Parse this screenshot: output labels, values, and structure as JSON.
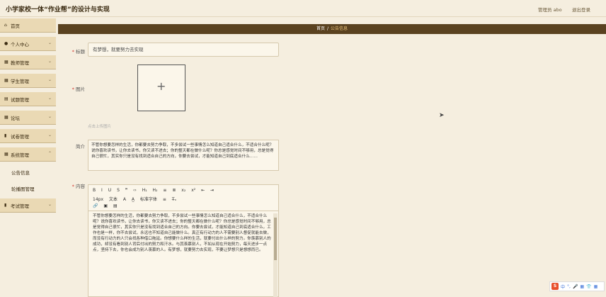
{
  "app": {
    "title": "小学家校一体“作业帮”的设计与实现",
    "user": "管理员 abo",
    "logout": "退出登录"
  },
  "sidebar": {
    "items": [
      {
        "label": "首页",
        "icon": "home-icon",
        "glyph": "⌂"
      },
      {
        "label": "个人中心",
        "icon": "user-icon",
        "glyph": "●"
      },
      {
        "label": "教师管理",
        "icon": "grid-icon",
        "glyph": "▦"
      },
      {
        "label": "学生管理",
        "icon": "grid-icon",
        "glyph": "▦"
      },
      {
        "label": "试题管理",
        "icon": "list-icon",
        "glyph": "▤"
      },
      {
        "label": "论坛",
        "icon": "grid-icon",
        "glyph": "▦"
      },
      {
        "label": "试卷管理",
        "icon": "doc-icon",
        "glyph": "▮"
      },
      {
        "label": "系统管理",
        "icon": "grid-icon",
        "glyph": "▦"
      },
      {
        "label": "考试管理",
        "icon": "doc-icon",
        "glyph": "▮"
      }
    ],
    "subitems": [
      "公告信息",
      "轮播图管理"
    ]
  },
  "breadcrumb": {
    "home": "首页",
    "separator": "/",
    "current": "公告信息"
  },
  "form": {
    "title_label": "标题",
    "title_value": "有梦想，就要努力去实现",
    "image_label": "图片",
    "image_hint": "点击上传图片",
    "summary_label": "简介",
    "summary_value": "不管你想要怎样的生活，你都要去努力争取，不多尝试一些事情怎么知道自己适合什么，不适合什么呢？说你喜欢读书，让你去读书，你又读不进去；你的整天都在做什么呢？你总是感觉时间不够用，总是觉得自己很忙，其实你只是没有找到适合自己的方向，你要去尝试，才能知道自己到底适合什么……",
    "content_label": "内容",
    "editor": {
      "toolbar_row1": [
        "B",
        "I",
        "U",
        "S",
        "❞",
        "‹›",
        "H₁",
        "H₂",
        "≡",
        "≣",
        "x₂",
        "x²",
        "⇤",
        "⇥"
      ],
      "toolbar_row2": [
        "14px",
        "文本",
        "A",
        "A̲",
        "标准字体",
        "≡",
        "T̶ₓ"
      ],
      "toolbar_row3": [
        "🔗",
        "▣",
        "▤"
      ],
      "content": "不管你想要怎样的生活，你都要去努力争取，不多尝试一些事情怎么知道自己适合什么，不适合什么呢？说你喜欢读书，让你去读书，你又读不进去；你的整天都在做什么呢？你总是感觉时间不够用，总是觉得自己很忙，其实你只是没有找到适合自己的方向。你要去尝试，才能知道自己到底适合什么，工作也是一样，你不去尝试，永远也不知道自己能做什么。真正有行动力的人不需要别人督促就能去做，而没有行动力的人只会找各种借口拖延。你想要什么样的生活，就要付出什么样的努力。你羡慕别人的成功，却没有看到别人背后付出的努力和汗水。与其羡慕别人，不如从现在开始努力，每天进步一点点，坚持下去，你也会成为别人羡慕的人。有梦想，就要努力去实现，不要让梦想只是想想而已。"
    }
  },
  "tray": {
    "logo": "S",
    "items": [
      "中",
      "°,",
      "🎤",
      "▦",
      "👕",
      "▦"
    ]
  }
}
